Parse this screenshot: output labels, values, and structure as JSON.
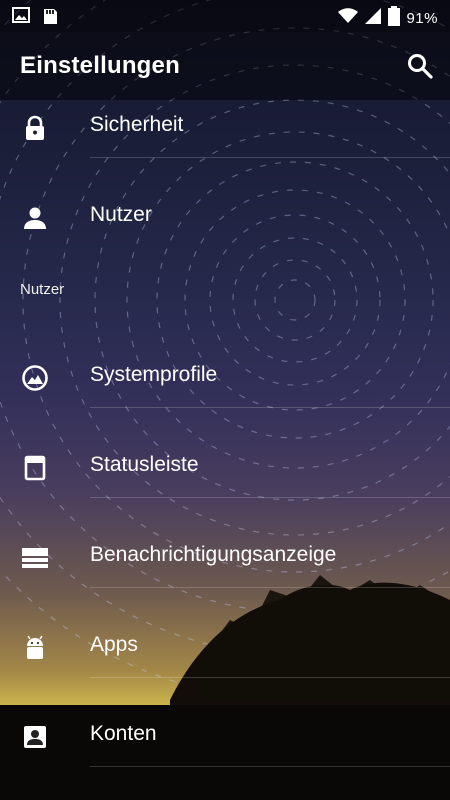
{
  "status_bar": {
    "left_icons": [
      "image-icon",
      "sd-card-icon"
    ],
    "right_icons": [
      "wifi-icon",
      "signal-icon",
      "battery-icon"
    ],
    "battery_text": "91%"
  },
  "app_bar": {
    "title": "Einstellungen",
    "search_icon": "search-icon"
  },
  "settings_items_top": [
    {
      "label": "Sicherheit",
      "icon": "lock-icon"
    },
    {
      "label": "Nutzer",
      "icon": "person-icon"
    }
  ],
  "section_header": "Nutzer",
  "settings_items": [
    {
      "label": "Systemprofile",
      "icon": "profile-icon"
    },
    {
      "label": "Statusleiste",
      "icon": "statusbar-icon"
    },
    {
      "label": "Benachrichtigungsanzeige",
      "icon": "notification-drawer-icon"
    },
    {
      "label": "Apps",
      "icon": "android-icon"
    },
    {
      "label": "Konten",
      "icon": "account-icon"
    }
  ],
  "colors": {
    "text": "#ffffff",
    "appbar_bg": "rgba(0,0,0,0.45)"
  }
}
